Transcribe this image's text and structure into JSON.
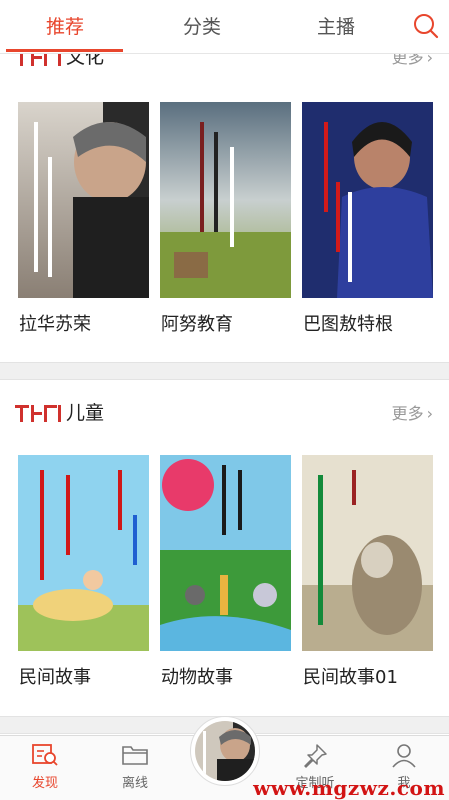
{
  "tabs": [
    {
      "label": "推荐",
      "active": true
    },
    {
      "label": "分类",
      "active": false
    },
    {
      "label": "主播",
      "active": false
    }
  ],
  "sections": [
    {
      "title": "文化",
      "more": "更多",
      "cards": [
        {
          "label": "拉华苏荣"
        },
        {
          "label": "阿努教育"
        },
        {
          "label": "巴图敖特根"
        }
      ]
    },
    {
      "title": "儿童",
      "more": "更多",
      "cards": [
        {
          "label": "民间故事"
        },
        {
          "label": "动物故事"
        },
        {
          "label": "民间故事01"
        }
      ]
    }
  ],
  "bottom_nav": [
    {
      "label": "发现",
      "icon": "discover-icon",
      "active": true
    },
    {
      "label": "离线",
      "icon": "folder-icon",
      "active": false
    },
    {
      "label": "定制听",
      "icon": "pin-icon",
      "active": false
    },
    {
      "label": "我",
      "icon": "user-icon",
      "active": false
    }
  ],
  "watermark": "www.mgzwz.com",
  "colors": {
    "accent": "#e8462d",
    "logo_red": "#d0312d"
  }
}
